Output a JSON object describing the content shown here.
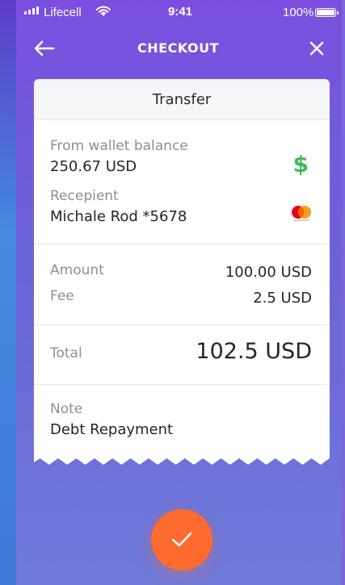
{
  "status_bar": {
    "carrier": "Lifecell",
    "time": "9:41",
    "battery": "100%"
  },
  "nav": {
    "title": "CHECKOUT",
    "back_icon": "arrow-left-icon",
    "close_icon": "close-icon"
  },
  "card": {
    "title": "Transfer",
    "from_label": "From wallet balance",
    "from_value": "250.67 USD",
    "from_icon": "dollar-icon",
    "recipient_label": "Recepient",
    "recipient_value": "Michale Rod *5678",
    "recipient_icon": "mastercard-icon",
    "amount_label": "Amount",
    "amount_value": "100.00 USD",
    "fee_label": "Fee",
    "fee_value": "2.5 USD",
    "total_label": "Total",
    "total_value": "102.5 USD",
    "note_label": "Note",
    "note_value": "Debt Repayment"
  },
  "confirm": {
    "icon": "checkmark-icon"
  },
  "colors": {
    "accent": "#ff6a2e",
    "dollar": "#3fba5b",
    "background_top": "#7a4fe0",
    "background_bottom": "#6f7bd9"
  }
}
